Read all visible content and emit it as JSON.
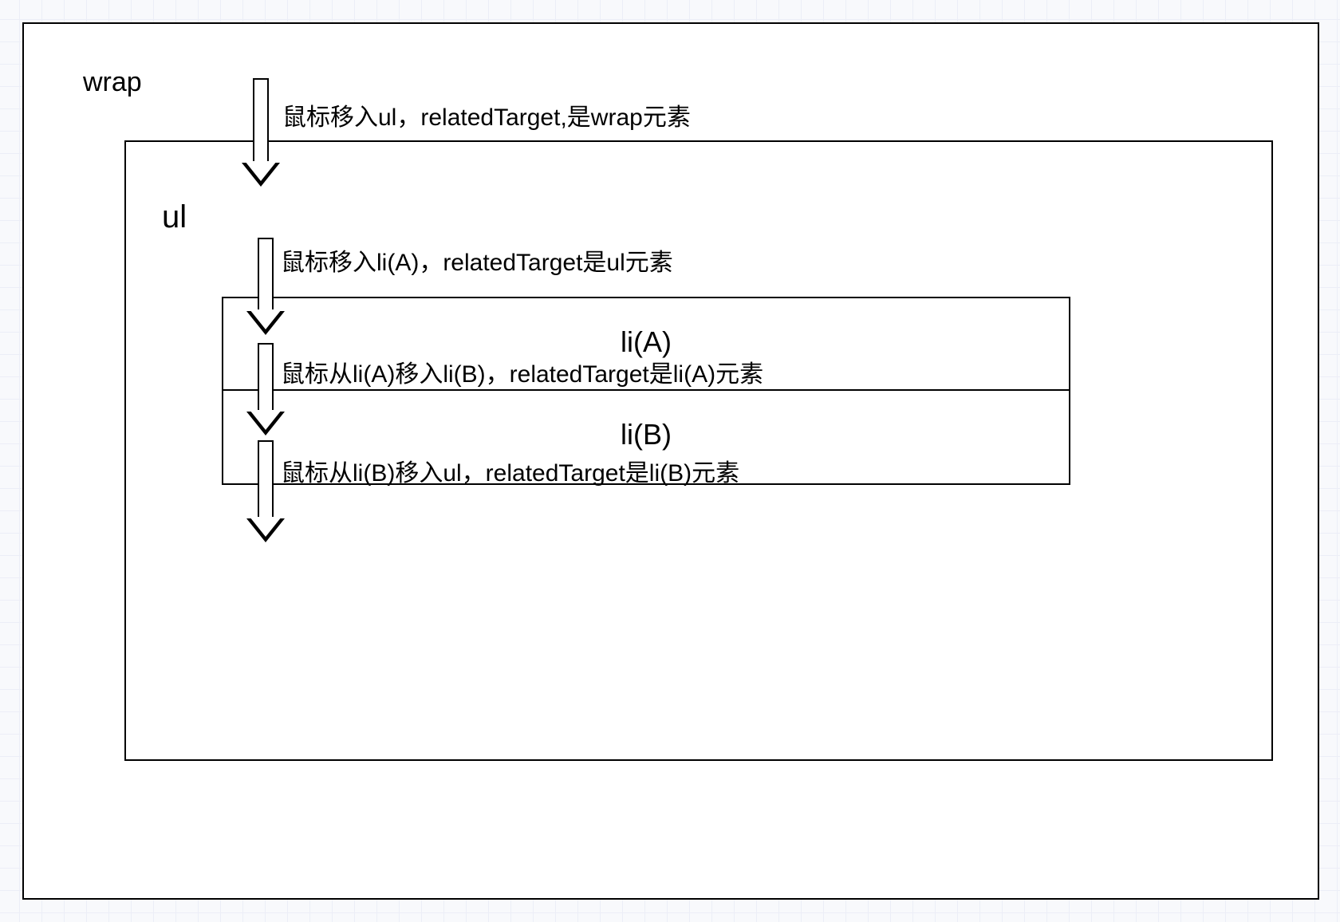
{
  "labels": {
    "wrap": "wrap",
    "ul": "ul",
    "liA": "li(A)",
    "liB": "li(B)"
  },
  "annotations": {
    "enter_ul": "鼠标移入ul，relatedTarget,是wrap元素",
    "enter_liA": "鼠标移入li(A)，relatedTarget是ul元素",
    "liA_to_liB": "鼠标从li(A)移入li(B)，relatedTarget是li(A)元素",
    "liB_to_ul": "鼠标从li(B)移入ul，relatedTarget是li(B)元素"
  }
}
